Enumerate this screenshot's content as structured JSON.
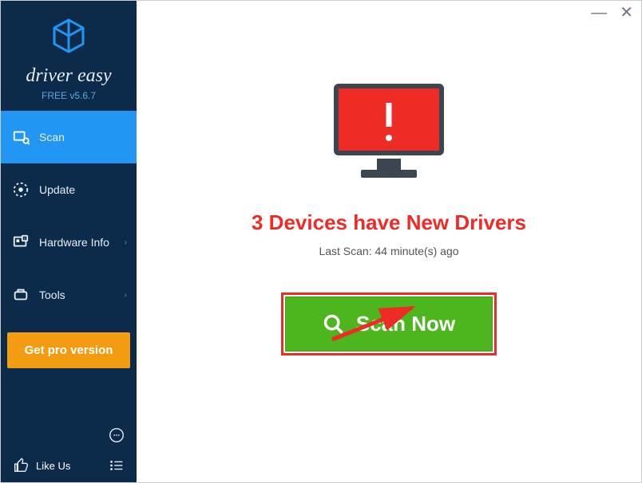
{
  "brand": {
    "name": "driver easy",
    "version": "FREE v5.6.7"
  },
  "sidebar": {
    "items": [
      {
        "label": "Scan",
        "icon": "scan-icon",
        "active": true,
        "chevron": false
      },
      {
        "label": "Update",
        "icon": "update-icon",
        "active": false,
        "chevron": false
      },
      {
        "label": "Hardware Info",
        "icon": "hardware-icon",
        "active": false,
        "chevron": true
      },
      {
        "label": "Tools",
        "icon": "tools-icon",
        "active": false,
        "chevron": true
      }
    ],
    "pro_button": "Get pro version",
    "like_us": "Like Us"
  },
  "main": {
    "headline": "3 Devices have New Drivers",
    "last_scan": "Last Scan: 44 minute(s) ago",
    "scan_button": "Scan Now"
  },
  "colors": {
    "sidebar_bg": "#0c2a4a",
    "active_bg": "#2196f3",
    "pro_bg": "#f39c12",
    "headline": "#ee2b24",
    "scan_bg": "#4db61f",
    "highlight_border": "#ee2b24"
  }
}
